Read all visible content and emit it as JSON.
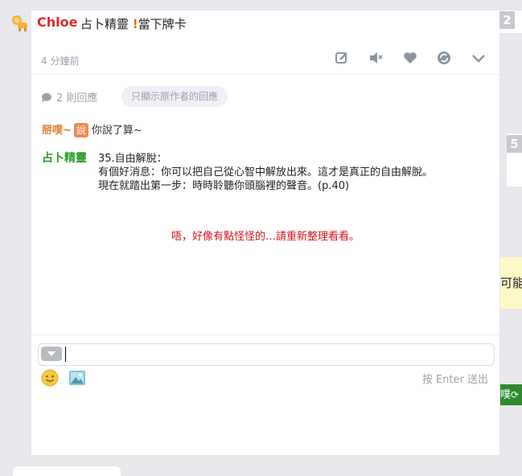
{
  "plurk": {
    "author": "Chloe",
    "text_before": "占卜精靈 ",
    "text_excl": "!",
    "text_after": "當下牌卡",
    "time": "4 分鐘前"
  },
  "actions": [
    "edit-icon",
    "mute-icon",
    "like-icon",
    "replurk-icon",
    "more-icon"
  ],
  "responses_bar": {
    "count_label": "2 則回應",
    "filter_label": "只顯示原作者的回應"
  },
  "responses": [
    {
      "author": "掰噗~",
      "qualifier": "說",
      "content": "你說了算~"
    },
    {
      "author": "占卜精靈",
      "line1": "35.自由解脫：",
      "line2": "有個好消息：你可以把自己從心智中解放出來。這才是真正的自由解脫。",
      "line3": "現在就踏出第一步：時時聆聽你頭腦裡的聲音。(p.40)"
    }
  ],
  "error_message": "唔，好像有點怪怪的…請重新整理看看。",
  "composer": {
    "enter_hint": "按 Enter 送出"
  },
  "side": {
    "badge_top": "2",
    "badge_mid": "5",
    "note_text": "可能",
    "green_text": "噗"
  },
  "colors": {
    "author": "#e0282d",
    "bot_author": "#2a9a2a",
    "error": "#d4131a",
    "muted": "#9aa3ad"
  }
}
